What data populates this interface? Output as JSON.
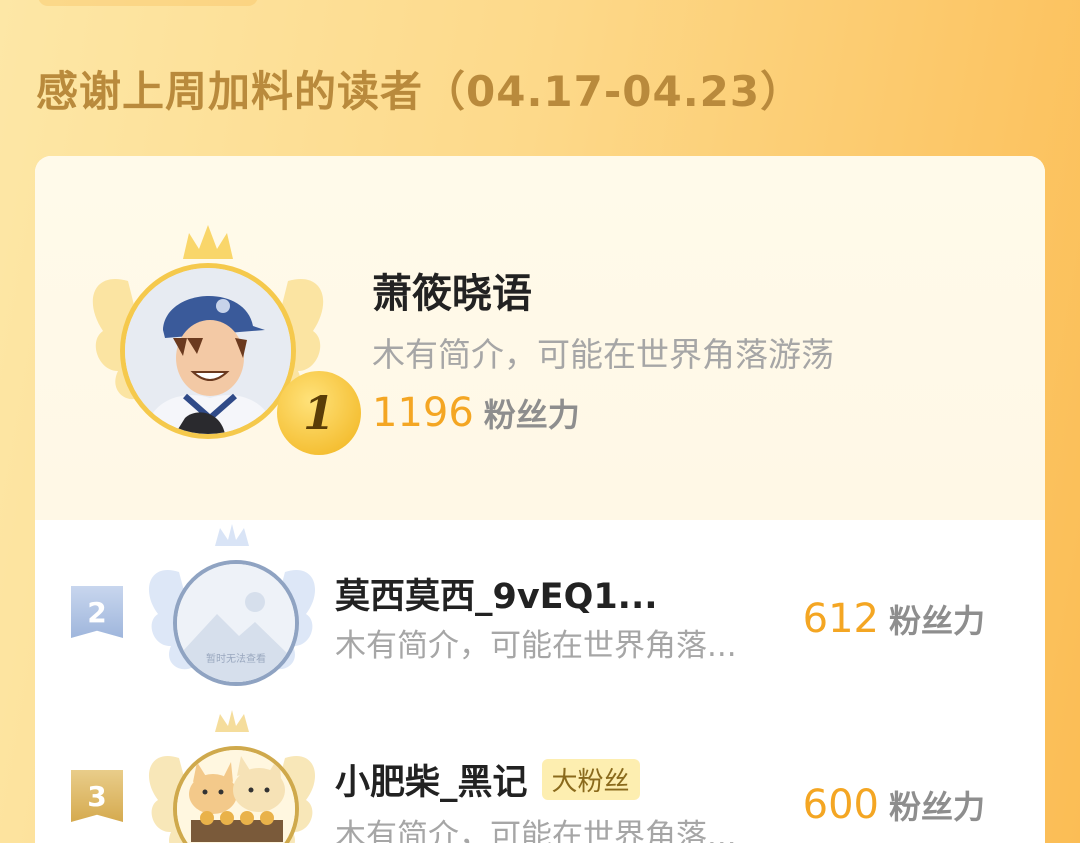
{
  "section": {
    "title": "感谢上周加料的读者（04.17-04.23）"
  },
  "ranking": [
    {
      "rank": "1",
      "name": "萧筱晓语",
      "bio": "木有简介，可能在世界角落游荡",
      "score": "1196",
      "unit": "粉丝力"
    },
    {
      "rank": "2",
      "name": "莫西莫西_9vEQ1...",
      "bio": "木有简介，可能在世界角落...",
      "score": "612",
      "unit": "粉丝力",
      "avatar_caption": "暂时无法查看"
    },
    {
      "rank": "3",
      "name": "小肥柴_黑记",
      "tag": "大粉丝",
      "bio": "木有简介，可能在世界角落...",
      "score": "600",
      "unit": "粉丝力"
    }
  ],
  "colors": {
    "accent_score": "#f4a623",
    "title": "#b98a3c",
    "gold_badge": "#f1b31b"
  }
}
